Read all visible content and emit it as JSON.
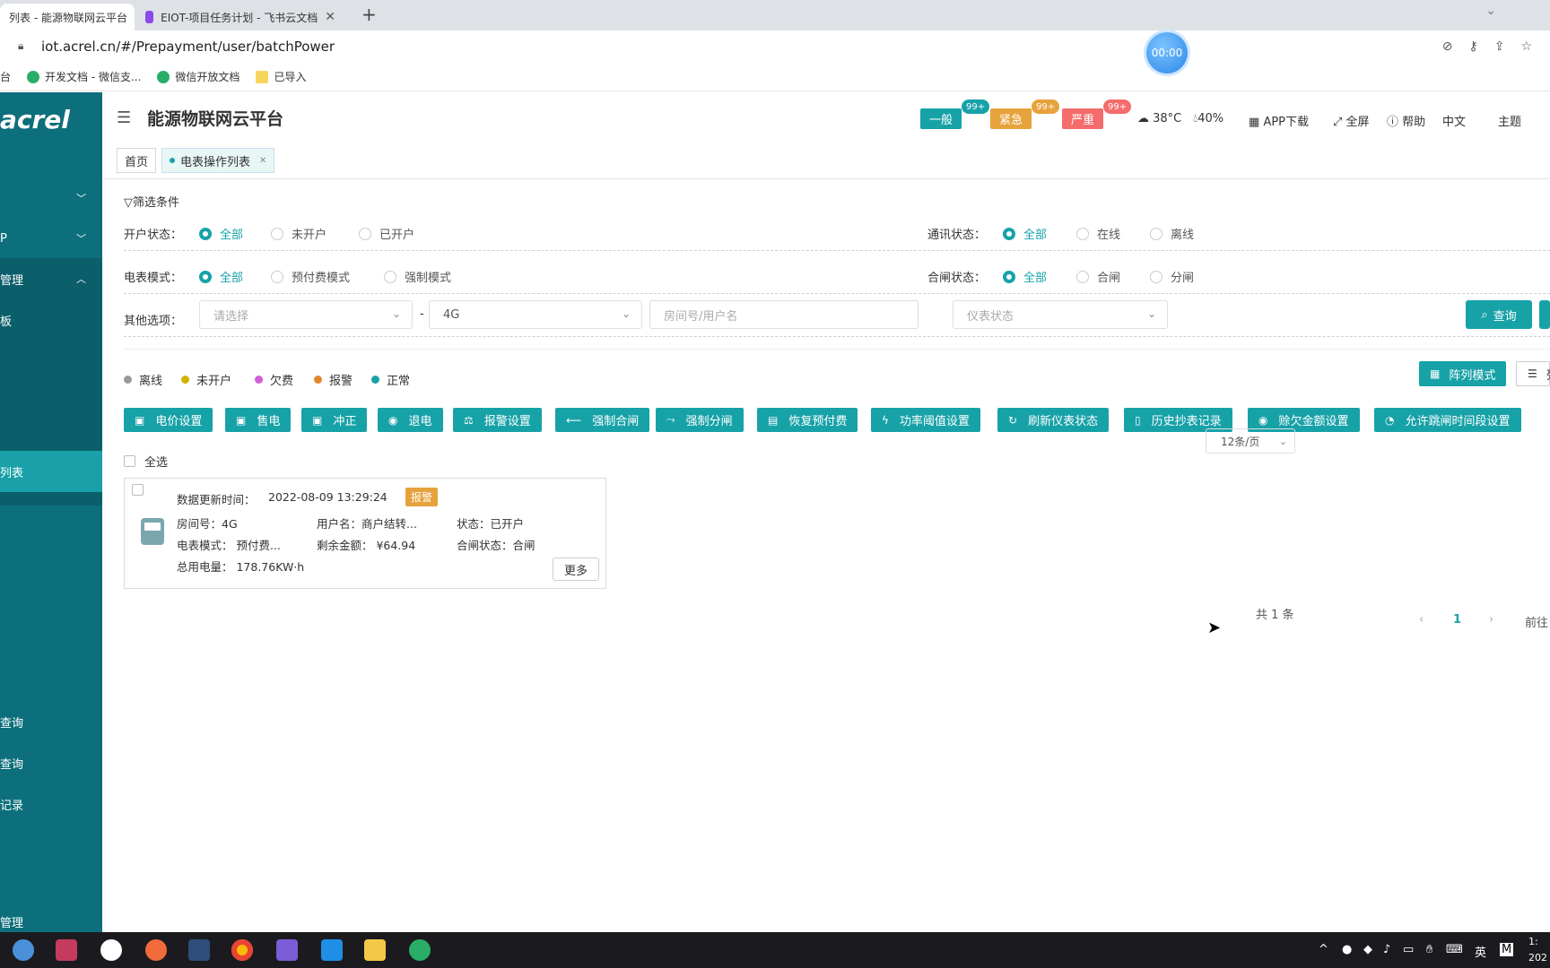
{
  "browser": {
    "tabs": [
      {
        "label": "列表 - 能源物联网云平台",
        "active": true
      },
      {
        "label": "EIOT-项目任务计划 - 飞书云文档",
        "active": false
      }
    ],
    "url": "iot.acrel.cn/#/Prepayment/user/batchPower",
    "timer": "00:00",
    "bookmarks": [
      "台",
      "开发文档 - 微信支...",
      "微信开放文档",
      "已导入"
    ]
  },
  "sidebar": {
    "logo": "acrel",
    "items": [
      {
        "label": "",
        "chevron": "v"
      },
      {
        "label": "P",
        "chevron": "v"
      },
      {
        "label": "管理",
        "chevron": "^"
      },
      {
        "label": "板"
      },
      {
        "label": "列表"
      },
      {
        "label": "查询"
      },
      {
        "label": "查询"
      },
      {
        "label": "记录"
      },
      {
        "label": "管理"
      }
    ]
  },
  "header": {
    "title": "能源物联网云平台",
    "alarms": [
      {
        "label": "一般",
        "count": "99+",
        "color": "#17a2a8"
      },
      {
        "label": "紧急",
        "count": "99+",
        "color": "#e6a23c"
      },
      {
        "label": "严重",
        "count": "99+",
        "color": "#f56c6c"
      }
    ],
    "temperature": "38°C",
    "humidity": "40%",
    "app_download": "APP下载",
    "fullscreen": "全屏",
    "help": "帮助",
    "language": "中文",
    "theme": "主题"
  },
  "breadcrumb_tabs": {
    "home": "首页",
    "current": "电表操作列表"
  },
  "filter": {
    "title": "筛选条件",
    "account_status": {
      "label": "开户状态：",
      "options": [
        "全部",
        "未开户",
        "已开户"
      ],
      "selected": "全部"
    },
    "comm_status": {
      "label": "通讯状态：",
      "options": [
        "全部",
        "在线",
        "离线"
      ],
      "selected": "全部"
    },
    "meter_mode": {
      "label": "电表模式：",
      "options": [
        "全部",
        "预付费模式",
        "强制模式"
      ],
      "selected": "全部"
    },
    "switch_status": {
      "label": "合闸状态：",
      "options": [
        "全部",
        "合闸",
        "分闸"
      ],
      "selected": "全部"
    },
    "other": {
      "label": "其他选项：",
      "select1_placeholder": "请选择",
      "separator": "-",
      "select2_value": "4G",
      "room_placeholder": "房间号/用户名",
      "meter_status_placeholder": "仪表状态"
    },
    "query_button": "查询"
  },
  "legend": [
    {
      "label": "离线",
      "color": "#999999"
    },
    {
      "label": "未开户",
      "color": "#d4b106"
    },
    {
      "label": "欠费",
      "color": "#d25ed8"
    },
    {
      "label": "报警",
      "color": "#e6862b"
    },
    {
      "label": "正常",
      "color": "#17a2a8"
    }
  ],
  "view_buttons": {
    "grid": "阵列模式",
    "list": "列"
  },
  "actions": [
    "电价设置",
    "售电",
    "冲正",
    "退电",
    "报警设置",
    "强制合闸",
    "强制分闸",
    "恢复预付费",
    "功率阈值设置",
    "刷新仪表状态",
    "历史抄表记录",
    "赊欠金额设置",
    "允许跳闸时间段设置"
  ],
  "select_all": "全选",
  "card": {
    "update_label": "数据更新时间：",
    "update_time": "2022-08-09 13:29:24",
    "tag": "报警",
    "room": "房间号：4G",
    "user": "用户名：商户结转...",
    "status": "状态：已开户",
    "mode": "电表模式：  预付费...",
    "balance": "剩余金额：  ¥64.94",
    "switch": "合闸状态：合闸",
    "total": "总用电量：  178.76KW·h",
    "more": "更多"
  },
  "pagination": {
    "total": "共 1 条",
    "page_size": "12条/页",
    "current": "1",
    "goto": "前往"
  },
  "taskbar": {
    "lang": "英",
    "ime": "M",
    "clock_top": "1:",
    "clock_bottom": "202"
  }
}
